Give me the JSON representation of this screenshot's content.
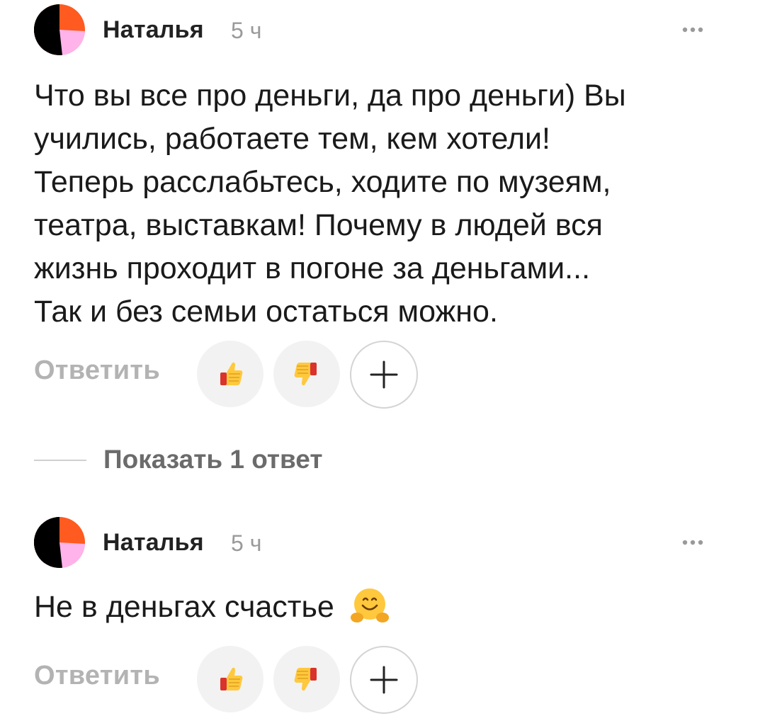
{
  "comments": [
    {
      "author": "Наталья",
      "time": "5 ч",
      "text_lines": [
        "Что вы все про деньги, да про деньги) Вы",
        "учились, работаете тем, кем хотели!",
        "Теперь расслабьтесь, ходите по музеям,",
        "театра, выставкам! Почему в людей вся",
        "жизнь проходит в погоне за деньгами...",
        "Так и без семьи остаться можно."
      ],
      "reply_label": "Ответить",
      "icons": {
        "avatar": "avatar-icon",
        "more": "more-dots-icon",
        "like": "thumbs-up-icon",
        "dislike": "thumbs-down-icon",
        "add": "plus-icon"
      }
    },
    {
      "author": "Наталья",
      "time": "5 ч",
      "text": "Не в деньгах счастье",
      "emoji": "hugging-face-icon",
      "reply_label": "Ответить",
      "icons": {
        "avatar": "avatar-icon",
        "more": "more-dots-icon",
        "like": "thumbs-up-icon",
        "dislike": "thumbs-down-icon",
        "add": "plus-icon"
      }
    }
  ],
  "show_replies": {
    "label": "Показать 1 ответ"
  },
  "colors": {
    "avatar_orange": "#ff5a1f",
    "avatar_pink": "#ffb3ea",
    "avatar_black": "#000000",
    "reply_text": "#b3b3b3",
    "time_text": "#9a9a9a",
    "button_bg": "#f2f2f2"
  }
}
